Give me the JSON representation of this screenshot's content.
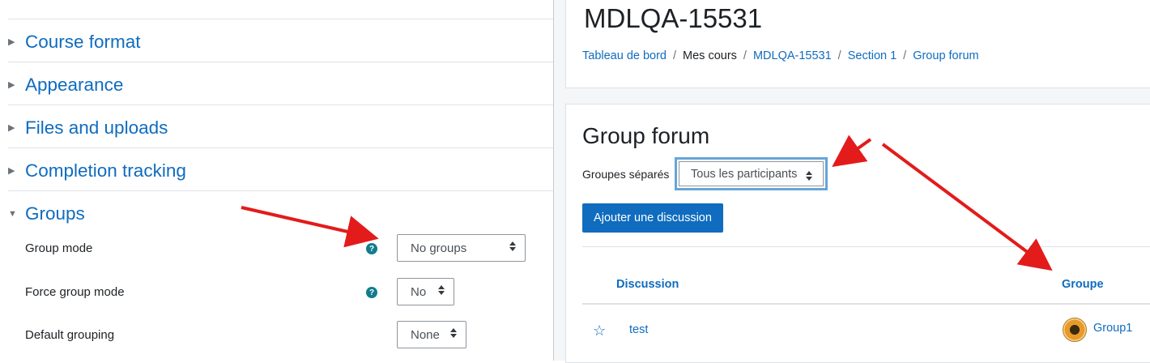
{
  "left_panel": {
    "sections": [
      {
        "label": "Course format",
        "expanded": false
      },
      {
        "label": "Appearance",
        "expanded": false
      },
      {
        "label": "Files and uploads",
        "expanded": false
      },
      {
        "label": "Completion tracking",
        "expanded": false
      },
      {
        "label": "Groups",
        "expanded": true
      }
    ],
    "fields": {
      "group_mode": {
        "label": "Group mode",
        "value": "No groups",
        "help_icon": "question-circle-icon"
      },
      "force_group_mode": {
        "label": "Force group mode",
        "value": "No",
        "help_icon": "question-circle-icon"
      },
      "default_grouping": {
        "label": "Default grouping",
        "value": "None"
      }
    }
  },
  "forum_window": {
    "course_title": "MDLQA-15531",
    "breadcrumb": [
      {
        "label": "Tableau de bord",
        "link": true
      },
      {
        "label": "Mes cours",
        "link": false
      },
      {
        "label": "MDLQA-15531",
        "link": true
      },
      {
        "label": "Section 1",
        "link": true
      },
      {
        "label": "Group forum",
        "link": true
      }
    ],
    "breadcrumb_separator": "/",
    "forum_title": "Group forum",
    "group_selector": {
      "label": "Groupes séparés",
      "value": "Tous les participants"
    },
    "add_discussion_label": "Ajouter une discussion",
    "table": {
      "headers": {
        "discussion": "Discussion",
        "group": "Groupe"
      },
      "rows": [
        {
          "discussion": "test",
          "group": "Group1",
          "starred": false
        }
      ]
    }
  },
  "colors": {
    "link": "#0f6cbf",
    "primary_button": "#0f6cbf",
    "help_icon": "#117d8c",
    "focus_border": "#66a5d8",
    "annotation_arrow": "#e31b1b"
  }
}
